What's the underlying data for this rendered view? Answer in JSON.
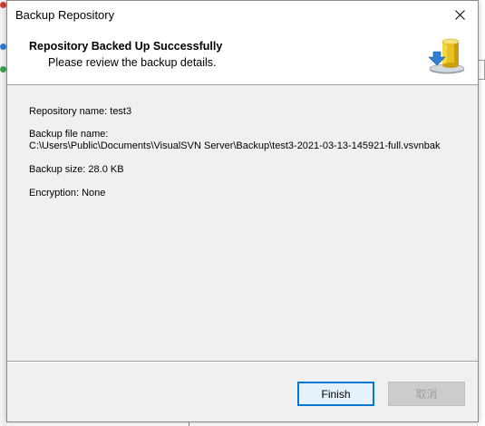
{
  "window": {
    "title": "Backup Repository",
    "close_icon": "close-icon"
  },
  "header": {
    "title": "Repository Backed Up Successfully",
    "subtitle": "Please review the backup details.",
    "icon": "database-download-icon"
  },
  "details": {
    "repository_name": "Repository name: test3",
    "backup_file_label": "Backup file name:",
    "backup_file_path": "C:\\Users\\Public\\Documents\\VisualSVN Server\\Backup\\test3-2021-03-13-145921-full.vsvnbak",
    "backup_size": "Backup size: 28.0 KB",
    "encryption": "Encryption: None"
  },
  "buttons": {
    "finish": "Finish",
    "cancel": "取消"
  },
  "colors": {
    "accent": "#0078d7",
    "dialog_bg": "#f0f0f0",
    "header_bg": "#ffffff",
    "disabled_text": "#a0a0a0"
  }
}
